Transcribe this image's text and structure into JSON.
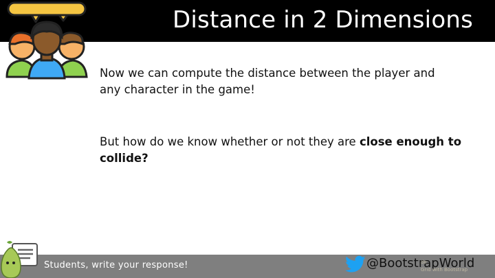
{
  "slide": {
    "title": "Distance in 2 Dimensions",
    "paragraph1": "Now we can compute the distance between the player and any character in the game!",
    "paragraph2_plain": "But how do we know whether or not they are ",
    "paragraph2_bold": "close enough to collide?"
  },
  "footer": {
    "prompt": "Students, write your response!",
    "handle": "@BootstrapWorld",
    "faint_line1": "de",
    "faint_line2": "Grid with Bootstrap"
  },
  "icons": {
    "people": "group-of-people-icon",
    "pear": "pear-deck-logo-icon",
    "twitter": "twitter-bird-icon"
  },
  "colors": {
    "title_bar": "#000000",
    "footer_bar": "#7f7f7f",
    "twitter_blue": "#1da1f2",
    "pear_green": "#a7c957"
  }
}
